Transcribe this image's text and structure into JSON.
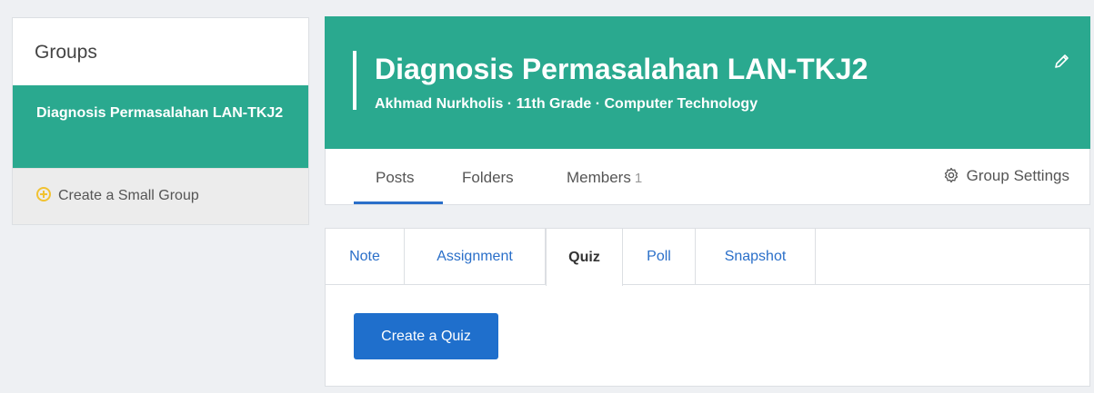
{
  "sidebar": {
    "title": "Groups",
    "active_group": "Diagnosis Permasalahan LAN-TKJ2",
    "create_label": "Create a Small Group"
  },
  "header": {
    "title": "Diagnosis Permasalahan LAN-TKJ2",
    "subtitle": "Akhmad Nurkholis · 11th Grade · Computer Technology"
  },
  "nav": {
    "tabs": [
      {
        "label": "Posts"
      },
      {
        "label": "Folders"
      },
      {
        "label": "Members",
        "count": "1"
      }
    ],
    "settings_label": "Group Settings"
  },
  "composer": {
    "tabs": [
      "Note",
      "Assignment",
      "Quiz",
      "Poll",
      "Snapshot"
    ],
    "active_tab": "Quiz",
    "action_label": "Create a Quiz"
  },
  "colors": {
    "brand": "#2aa98f",
    "primary_button": "#1f6fcc",
    "tab_link": "#2a6fc9"
  }
}
